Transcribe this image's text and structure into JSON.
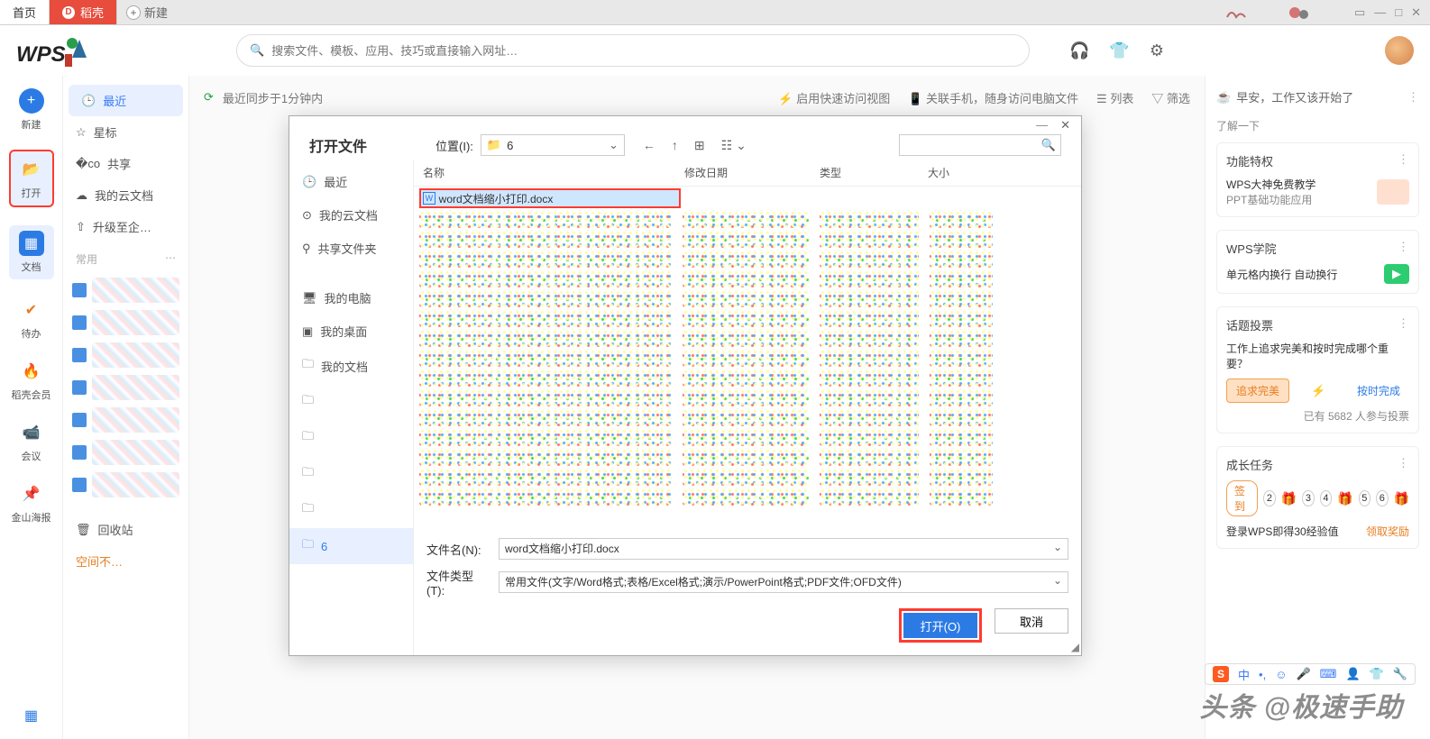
{
  "tabs": {
    "home": "首页",
    "doku": "稻壳",
    "new": "新建"
  },
  "search": {
    "placeholder": "搜索文件、模板、应用、技巧或直接输入网址…"
  },
  "leftRail": {
    "new": "新建",
    "open": "打开",
    "docs": "文档",
    "todo": "待办",
    "vip": "稻壳会员",
    "meeting": "会议",
    "poster": "金山海报"
  },
  "sidebar": {
    "items": {
      "recent": "最近",
      "star": "星标",
      "share": "共享",
      "cloud": "我的云文档",
      "upgrade": "升级至企…"
    },
    "common_label": "常用",
    "trash": "回收站",
    "space": "空间不…"
  },
  "centerTop": {
    "sync": "最近同步于1分钟内",
    "quick": "启用快速访问视图",
    "phone": "关联手机，随身访问电脑文件",
    "list": "列表",
    "filter": "筛选"
  },
  "rightPanel": {
    "greeting": "早安，工作又该开始了",
    "learn": "了解一下",
    "card1_title": "功能特权",
    "card1_line1": "WPS大神免费教学",
    "card1_line2": "PPT基础功能应用",
    "card2_title": "WPS学院",
    "card2_line": "单元格内换行 自动换行",
    "vote_title": "话题投票",
    "vote_q": "工作上追求完美和按时完成哪个重要？",
    "vote_a": "追求完美",
    "vote_b": "按时完成",
    "vote_count": "已有 5682 人参与投票",
    "growth_title": "成长任务",
    "growth_badge": "签到",
    "growth_nums": [
      "2",
      "3",
      "4",
      "5",
      "6"
    ],
    "growth_login": "登录WPS即得30经验值",
    "growth_reward": "领取奖励",
    "ime_text": "中"
  },
  "dialog": {
    "title": "打开文件",
    "loc_label": "位置(I):",
    "loc_value": "6",
    "nav": {
      "recent": "最近",
      "cloud": "我的云文档",
      "shared": "共享文件夹",
      "pc": "我的电脑",
      "desktop": "我的桌面",
      "mydocs": "我的文档",
      "folder6": "6"
    },
    "columns": {
      "name": "名称",
      "date": "修改日期",
      "type": "类型",
      "size": "大小"
    },
    "selected_file": "word文档缩小打印.docx",
    "filename_label": "文件名(N):",
    "filename_value": "word文档缩小打印.docx",
    "filetype_label": "文件类型(T):",
    "filetype_value": "常用文件(文字/Word格式;表格/Excel格式;演示/PowerPoint格式;PDF文件;OFD文件)",
    "open_btn": "打开(O)",
    "cancel_btn": "取消"
  },
  "watermark": "头条 @极速手助"
}
